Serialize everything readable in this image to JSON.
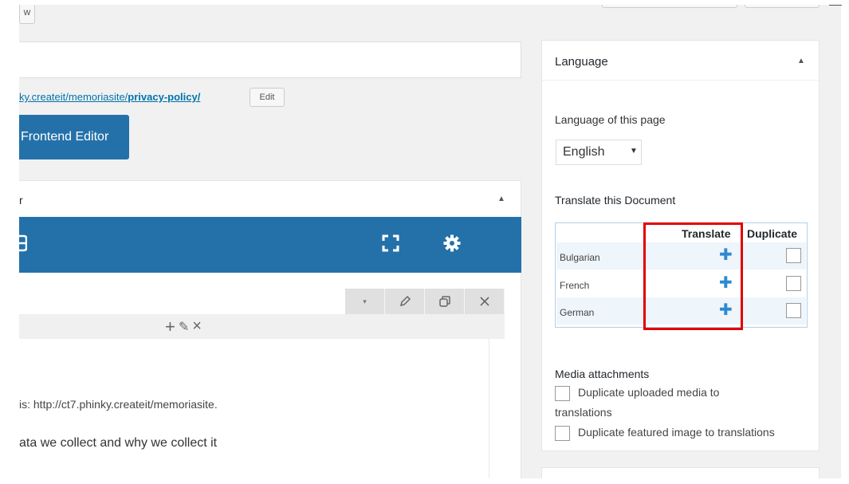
{
  "top_buttons": {
    "preview_label": "w"
  },
  "permalink": {
    "url_prefix": "ky.createit/memoriasite/",
    "slug": "privacy-policy/",
    "edit_label": "Edit"
  },
  "frontend_button": {
    "label": "Frontend Editor"
  },
  "editor_box": {
    "title": "r",
    "toggle": "▲"
  },
  "composer": {
    "column_controls": {
      "add": "+",
      "edit": "✎",
      "delete": "×"
    }
  },
  "content": {
    "line1": "is: http://ct7.phinky.createit/memoriasite.",
    "line2": "ata we collect and why we collect it"
  },
  "language_panel": {
    "title": "Language",
    "toggle": "▲",
    "language_of_page_label": "Language of this page",
    "selected_language": "English",
    "select_arrow": "▼",
    "translate_label": "Translate this Document",
    "table": {
      "header_translate": "Translate",
      "header_duplicate": "Duplicate",
      "rows": [
        {
          "language": "Bulgarian",
          "action": "✚"
        },
        {
          "language": "French",
          "action": "✚"
        },
        {
          "language": "German",
          "action": "✚"
        }
      ]
    },
    "media_label": "Media attachments",
    "media_option1_line1": "Duplicate uploaded media to",
    "media_option1_line2": "translations",
    "media_option2": "Duplicate featured image to translations"
  },
  "colors": {
    "accent": "#2471aa",
    "link": "#0073aa",
    "highlight": "#e00000",
    "plus": "#2e8ad0"
  }
}
